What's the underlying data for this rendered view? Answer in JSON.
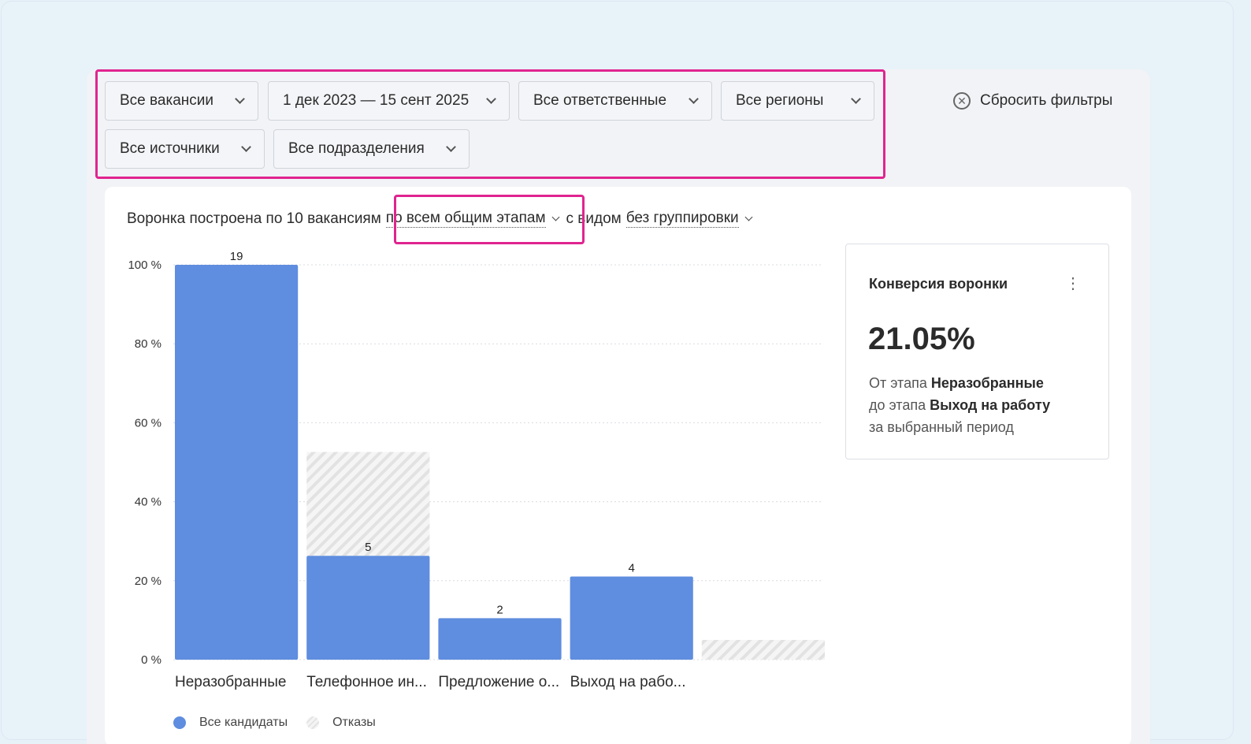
{
  "filters": {
    "vacancies": "Все вакансии",
    "period": "1 дек 2023 — 15 сент 2025",
    "responsible": "Все ответственные",
    "regions": "Все регионы",
    "sources": "Все источники",
    "departments": "Все подразделения",
    "reset_label": "Сбросить фильтры"
  },
  "funnel": {
    "prefix": "Воронка построена по 10 вакансиям",
    "stage_mode": "по всем общим этапам",
    "middle": "с видом",
    "grouping": "без группировки"
  },
  "conversion": {
    "title": "Конверсия воронки",
    "value": "21.05%",
    "line1_prefix": "От этапа",
    "line1_stage": "Неразобранные",
    "line2_prefix": "до этапа",
    "line2_stage": "Выход на работу",
    "line3": "за выбранный период"
  },
  "legend": {
    "all": "Все кандидаты",
    "rejections": "Отказы"
  },
  "colors": {
    "bar": "#5f8ddf",
    "accent_highlight": "#e0248f"
  },
  "chart_data": {
    "type": "bar",
    "categories": [
      "Неразобранные",
      "Телефонное ин...",
      "Предложение о...",
      "Выход на рабо...",
      ""
    ],
    "series": [
      {
        "name": "Все кандидаты",
        "values": [
          100,
          26.3,
          10.5,
          21.05,
          0
        ],
        "labels": [
          "19",
          "5",
          "2",
          "4",
          ""
        ]
      },
      {
        "name": "Отказы",
        "values": [
          0,
          26.3,
          0,
          0,
          5
        ]
      }
    ],
    "y_ticks": [
      "0 %",
      "20 %",
      "40 %",
      "60 %",
      "80 %",
      "100 %"
    ],
    "ylim": [
      0,
      100
    ],
    "grid": true,
    "legend_position": "bottom-left"
  }
}
